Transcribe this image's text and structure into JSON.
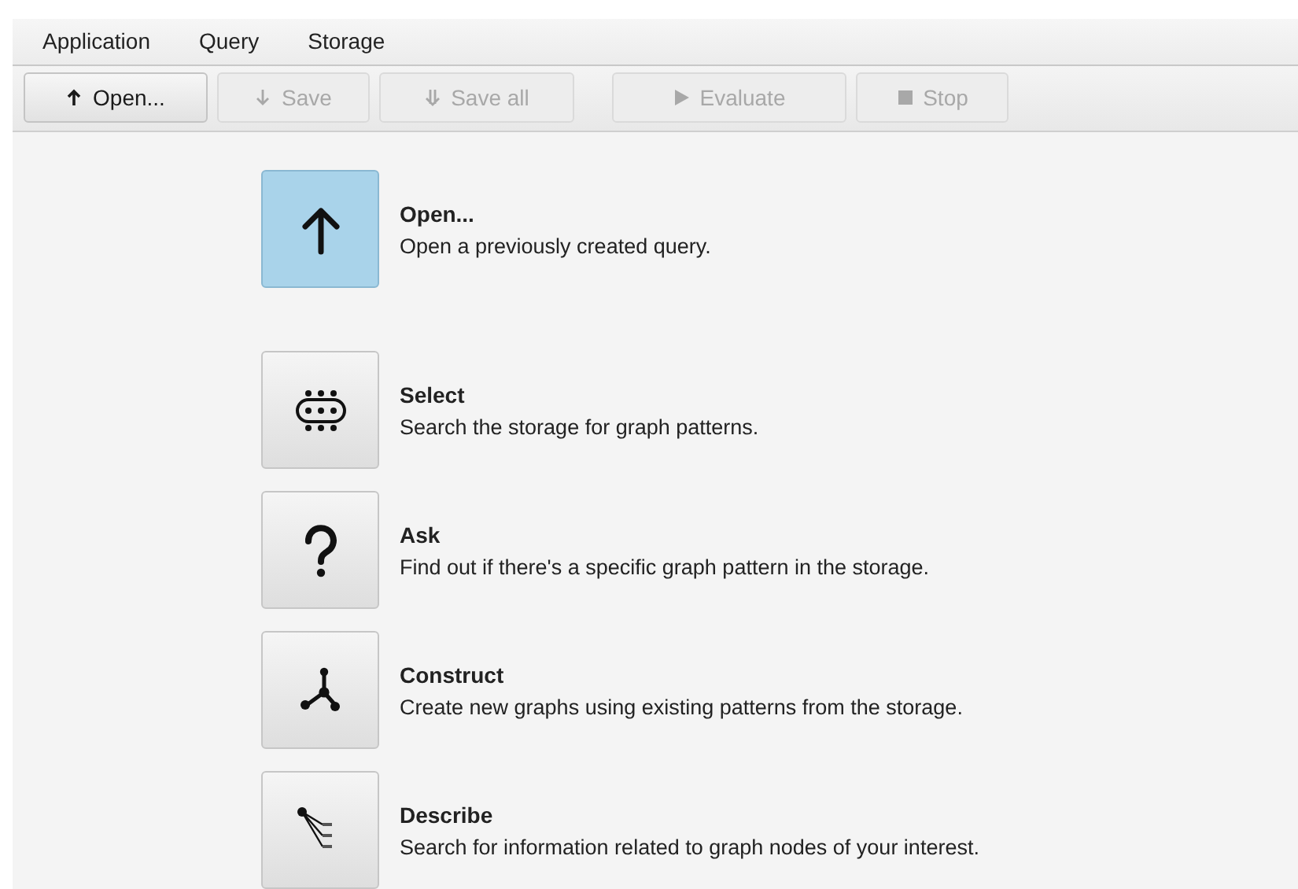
{
  "menu_bar": [
    {
      "label": "Application"
    },
    {
      "label": "Query"
    },
    {
      "label": "Storage"
    }
  ],
  "toolbar_groups": [
    {
      "buttons": [
        {
          "kind": "up",
          "label": "Open...",
          "disabled": false
        },
        {
          "kind": "down",
          "label": "Save",
          "disabled": true
        },
        {
          "kind": "double-down",
          "label": "Save all",
          "disabled": true
        }
      ]
    },
    {
      "buttons": [
        {
          "kind": "play",
          "label": "Evaluate",
          "disabled": true
        },
        {
          "kind": "stop",
          "label": "Stop",
          "disabled": true
        }
      ]
    }
  ],
  "open_action": {
    "kind": "up",
    "title": "Open...",
    "description": "Open a previously created query.",
    "selected": true
  },
  "query_types": [
    {
      "kind": "select",
      "title": "Select",
      "description": "Search the storage for graph patterns.",
      "selected": false
    },
    {
      "kind": "ask",
      "title": "Ask",
      "description": "Find out if there's a specific graph pattern in the storage.",
      "selected": false
    },
    {
      "kind": "construct",
      "title": "Construct",
      "description": "Create new graphs using existing patterns from the storage.",
      "selected": false
    },
    {
      "kind": "describe",
      "title": "Describe",
      "description": "Search for information related to graph nodes of your interest.",
      "selected": false
    }
  ]
}
